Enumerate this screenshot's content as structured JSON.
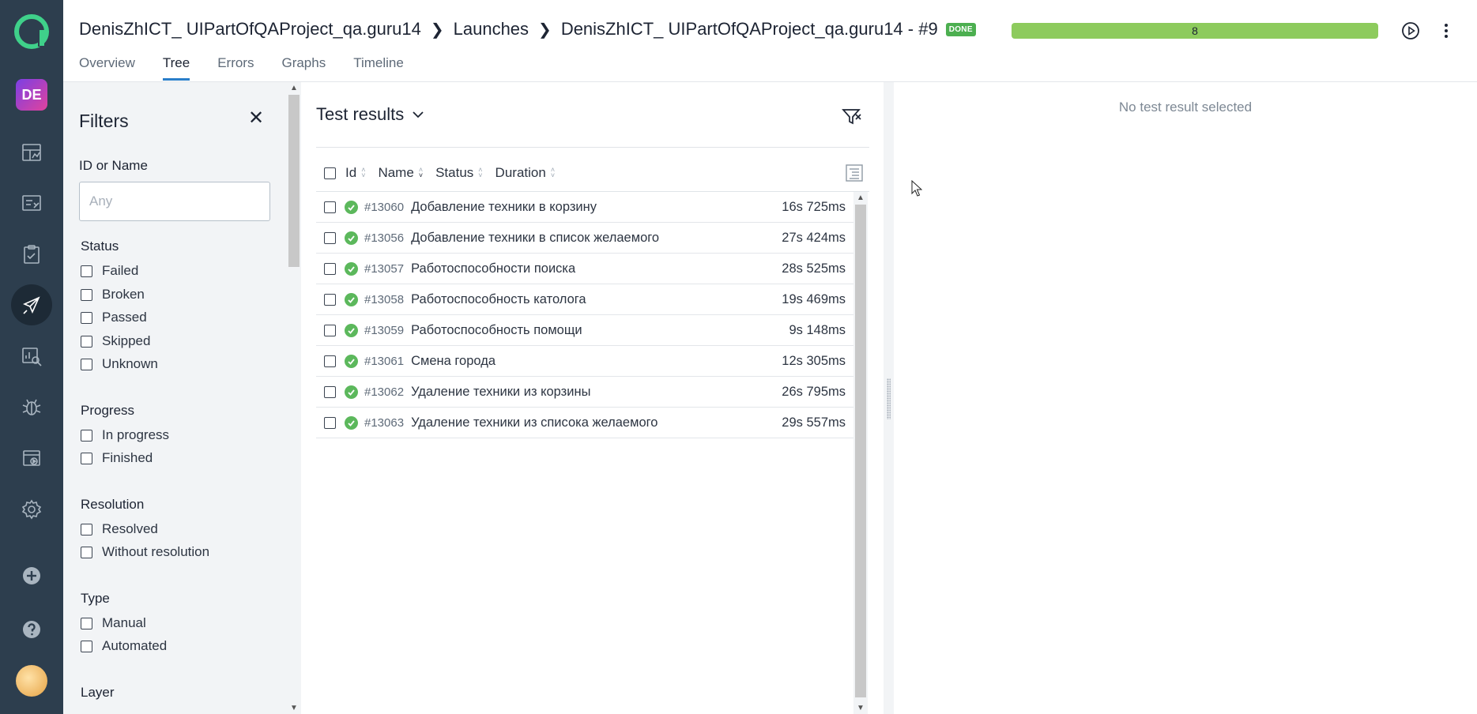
{
  "header": {
    "breadcrumb": {
      "project": "DenisZhICT_ UIPartOfQAProject_qa.guru14",
      "section": "Launches",
      "launch": "DenisZhICT_ UIPartOfQAProject_qa.guru14 - #9"
    },
    "status_badge": "DONE",
    "progress_count": "8",
    "tabs": [
      "Overview",
      "Tree",
      "Errors",
      "Graphs",
      "Timeline"
    ],
    "active_tab": "Tree"
  },
  "nav": {
    "project_initials": "DE",
    "items": [
      "dashboards-icon",
      "test-cases-icon",
      "test-plans-icon",
      "launches-icon",
      "analytics-icon",
      "defects-icon",
      "jobs-icon",
      "settings-icon",
      "add-icon",
      "help-icon"
    ],
    "active": "launches-icon"
  },
  "filters": {
    "title": "Filters",
    "id_or_name": {
      "label": "ID or Name",
      "placeholder": "Any"
    },
    "groups": [
      {
        "title": "Status",
        "options": [
          "Failed",
          "Broken",
          "Passed",
          "Skipped",
          "Unknown"
        ]
      },
      {
        "title": "Progress",
        "options": [
          "In progress",
          "Finished"
        ]
      },
      {
        "title": "Resolution",
        "options": [
          "Resolved",
          "Without resolution"
        ]
      },
      {
        "title": "Type",
        "options": [
          "Manual",
          "Automated"
        ]
      },
      {
        "title": "Layer",
        "options": []
      }
    ]
  },
  "results": {
    "title": "Test results",
    "columns": [
      "Id",
      "Name",
      "Status",
      "Duration"
    ],
    "rows": [
      {
        "id": "#13060",
        "name": "Добавление техники в корзину",
        "status": "passed",
        "duration": "16s 725ms"
      },
      {
        "id": "#13056",
        "name": "Добавление техники в список желаемого",
        "status": "passed",
        "duration": "27s 424ms"
      },
      {
        "id": "#13057",
        "name": "Работоспособности поиска",
        "status": "passed",
        "duration": "28s 525ms"
      },
      {
        "id": "#13058",
        "name": "Работоспособность католога",
        "status": "passed",
        "duration": "19s 469ms"
      },
      {
        "id": "#13059",
        "name": "Работоспособность помощи",
        "status": "passed",
        "duration": "9s 148ms"
      },
      {
        "id": "#13061",
        "name": "Смена города",
        "status": "passed",
        "duration": "12s 305ms"
      },
      {
        "id": "#13062",
        "name": "Удаление техники из корзины",
        "status": "passed",
        "duration": "26s 795ms"
      },
      {
        "id": "#13063",
        "name": "Удаление техники из списока желаемого",
        "status": "passed",
        "duration": "29s 557ms"
      }
    ]
  },
  "detail": {
    "empty_text": "No test result selected"
  },
  "colors": {
    "rail": "#2d3e4e",
    "accent": "#2a7ec9",
    "passed": "#5cb85c",
    "progress": "#8dcb5d",
    "done_badge": "#4caf50"
  }
}
